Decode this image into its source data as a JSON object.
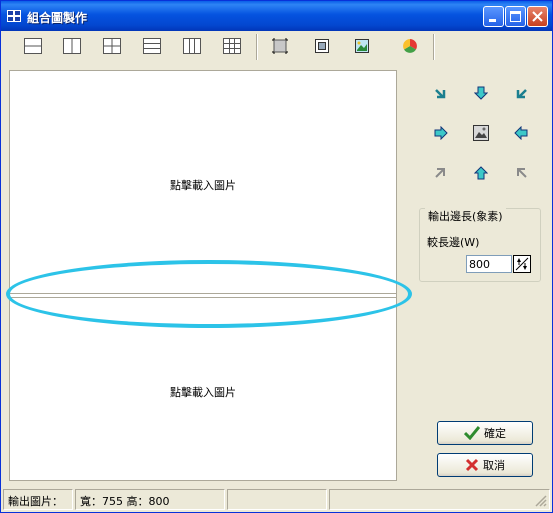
{
  "window": {
    "title": "組合圖製作"
  },
  "toolbar": {
    "tools": [
      "layout-2-rows-icon",
      "layout-2-cols-icon",
      "layout-grid-2x2-icon",
      "layout-3-rows-icon",
      "layout-3-cols-icon",
      "layout-grid-3x3-icon",
      "crop-icon",
      "fit-frame-icon",
      "stretch-icon",
      "color-wheel-icon"
    ]
  },
  "canvas": {
    "top_panel_text": "點擊載入圖片",
    "bottom_panel_text": "點擊載入圖片"
  },
  "alignment": {
    "buttons": [
      "align-top-left-icon",
      "align-top-icon",
      "align-top-right-icon",
      "align-left-icon",
      "align-center-icon",
      "align-right-icon",
      "align-bottom-left-icon",
      "align-bottom-icon",
      "align-bottom-right-icon"
    ]
  },
  "output": {
    "group_label": "輸出邊長(象素)",
    "long_side_label": "較長邊(W)",
    "long_side_value": "800"
  },
  "buttons": {
    "ok_label": "確定",
    "cancel_label": "取消"
  },
  "status": {
    "label": "輸出圖片：",
    "size": "寬：755 高：800"
  },
  "colors": {
    "highlight_ellipse": "#2cc3e8",
    "title_bar": "#0553e0"
  }
}
